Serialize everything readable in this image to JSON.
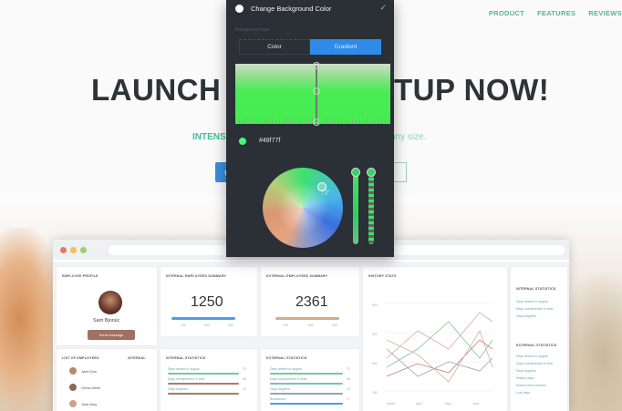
{
  "nav": {
    "items": [
      "PRODUCT",
      "FEATURES",
      "REVIEWS"
    ]
  },
  "hero": {
    "title_left": "LAUNCH Y",
    "title_right": "TUP NOW!",
    "subtitle_left": "INTENSE",
    "subtitle_right": "any size.",
    "cta_icon": "basket-icon",
    "cta_label": "G"
  },
  "colors": {
    "accent_green": "#52b788",
    "picker_bg": "#2b2f36",
    "gradient_tab": "#2f8ae8",
    "selected_color": "#48f77f",
    "dashboard_blue": "#4c9ee8"
  },
  "picker": {
    "title": "Change Background Color",
    "confirm_icon": "check-icon",
    "type_caption": "Background type",
    "tabs": [
      {
        "label": "Color",
        "active": false
      },
      {
        "label": "Gradient",
        "active": true
      }
    ],
    "hex_value": "#48f77f"
  },
  "dashboard": {
    "employee_profile": {
      "title": "EMPLOYEE PROFILE",
      "name": "Sam Bjorsic",
      "button": "Send message"
    },
    "internal_summary": {
      "title": "INTERNAL EMPLOYEES SUMMARY",
      "value": "1250",
      "legend": [
        "100",
        "800",
        "500"
      ]
    },
    "external_summary": {
      "title": "EXTERNAL EMPLOYEES SUMMARY",
      "value": "2361",
      "legend": [
        "100",
        "800",
        "500"
      ]
    },
    "history": {
      "title": "HISTORY STATS",
      "yticks": [
        "500",
        "400",
        "300",
        "200",
        "100"
      ],
      "xticks": [
        "March",
        "April",
        "May",
        "June"
      ]
    },
    "internal_statistics": {
      "title": "INTERNAL STATISTICS",
      "items": [
        "Days absent in august",
        "Days overspended in time",
        "Days targeted"
      ]
    },
    "external_statistics": {
      "title": "EXTERNAL STATISTICS",
      "items": [
        "Days absent in august",
        "Days overspended in time",
        "Days targeted",
        "Missed days",
        "Missed time overtime",
        "Lost days"
      ]
    },
    "employee_list": {
      "title": "LIST OF EMPLOYEES",
      "filter": "INTERNAL",
      "rows": [
        "Jane Doe",
        "Olivia Wells",
        "Julia Way"
      ]
    },
    "internal_stats_small": {
      "title": "INTERNAL STATISTICS",
      "items": [
        "Days absent in august",
        "Days overspended in time",
        "Days targeted"
      ],
      "values": [
        "23",
        "58",
        "10"
      ]
    },
    "external_stats_small": {
      "title": "EXTERNAL STATISTICS",
      "items": [
        "Days absent in august",
        "Days overspended in time",
        "Days targeted",
        "Breakdown"
      ],
      "values": [
        "23",
        "58",
        "10",
        "17"
      ]
    }
  }
}
